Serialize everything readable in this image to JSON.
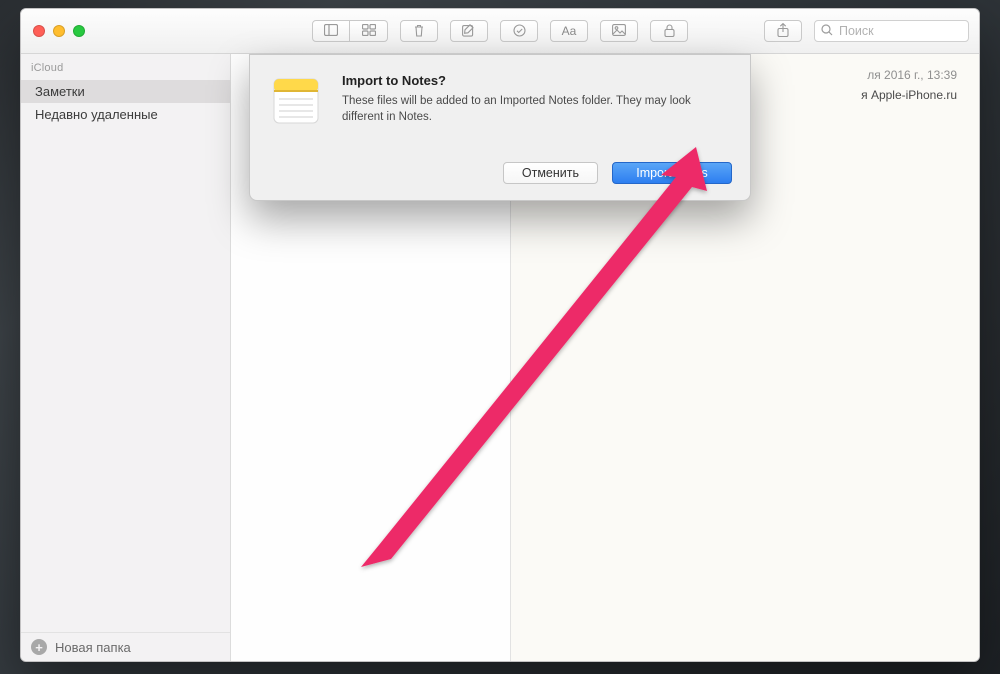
{
  "sidebar": {
    "header": "iCloud",
    "items": [
      {
        "label": "Заметки",
        "selected": true
      },
      {
        "label": "Недавно удаленные",
        "selected": false
      }
    ],
    "new_folder_label": "Новая папка"
  },
  "toolbar": {
    "search_placeholder": "Поиск"
  },
  "detail": {
    "timestamp_fragment": "ля 2016 г., 13:39",
    "title_fragment": "я Apple-iPhone.ru"
  },
  "dialog": {
    "title": "Import to Notes?",
    "message": "These files will be added to an Imported Notes folder. They may look different in Notes.",
    "cancel_label": "Отменить",
    "confirm_label": "Import Notes"
  }
}
